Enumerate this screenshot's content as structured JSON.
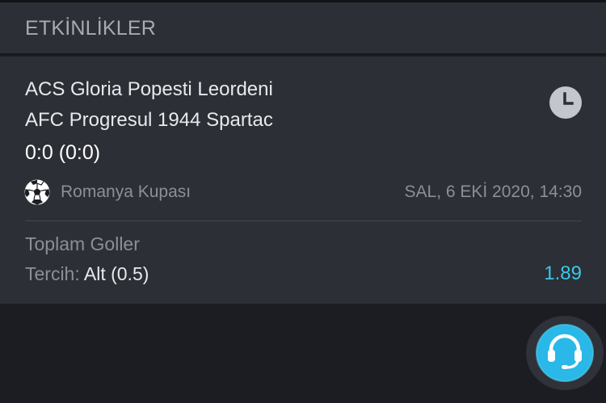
{
  "section": {
    "title": "ETKİNLİKLER"
  },
  "event": {
    "home_team": "ACS Gloria Popesti Leordeni",
    "away_team": "AFC Progresul 1944 Spartac",
    "score": "0:0 (0:0)",
    "status_icon": "clock-icon",
    "sport_icon": "soccer-ball-icon",
    "league": "Romanya Kupası",
    "date": "SAL, 6 EKİ 2020, 14:30"
  },
  "bet": {
    "market": "Toplam Goller",
    "selection_label": "Tercih:",
    "selection_value": "Alt (0.5)",
    "odds": "1.89"
  },
  "support": {
    "icon": "headset-icon"
  },
  "colors": {
    "background": "#1b1d22",
    "card": "#2c2f35",
    "accent_odds": "#3bc7e8",
    "support_button": "#29b8e8"
  }
}
